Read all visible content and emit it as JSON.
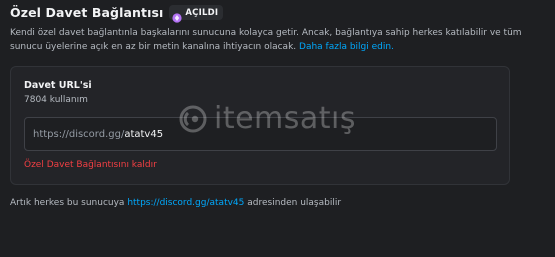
{
  "header": {
    "title": "Özel Davet Bağlantısı",
    "badge": {
      "icon": "boost-gem-icon",
      "label": "AÇILDI",
      "icon_color": "#b473f5"
    }
  },
  "description": {
    "text": "Kendi özel davet bağlantınla başkalarını sunucuna kolayca getir. Ancak, bağlantıya sahip herkes katılabilir ve tüm sunucu üyelerine açık en az bir metin kanalına ihtiyacın olacak. ",
    "link_label": "Daha fazla bilgi edin."
  },
  "vanity": {
    "title": "Davet URL'si",
    "uses": "7804 kullanım",
    "prefix": "https://discord.gg/",
    "code": "atatv45",
    "revoke_label": "Özel Davet Bağlantısını kaldır"
  },
  "footer": {
    "before": "Artık herkes bu sunucuya ",
    "link": "https://discord.gg/atatv45",
    "after": " adresinden ulaşabilir"
  },
  "watermark": {
    "text": "itemsatış"
  },
  "colors": {
    "background": "#1e1f22",
    "card": "#232428",
    "link": "#00a8fc",
    "danger": "#f23f43"
  }
}
